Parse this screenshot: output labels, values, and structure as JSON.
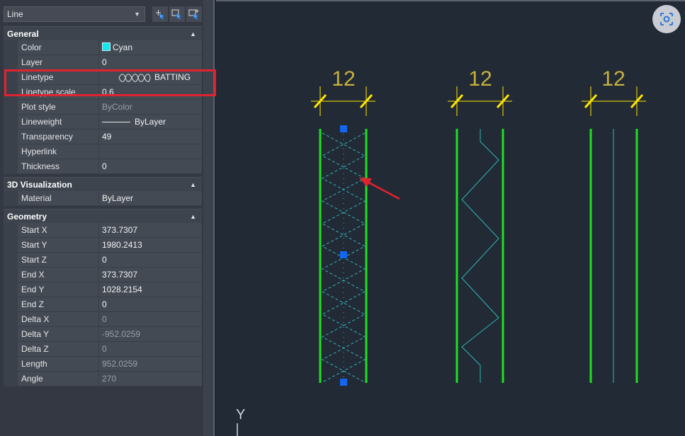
{
  "selector": {
    "value": "Line"
  },
  "toolbar": {
    "icons": [
      "select-objects-icon",
      "quick-select-icon",
      "toggle-pickadd-icon"
    ]
  },
  "sections": {
    "general": {
      "title": "General"
    },
    "viz": {
      "title": "3D Visualization"
    },
    "geometry": {
      "title": "Geometry"
    }
  },
  "general": {
    "color": {
      "label": "Color",
      "value": "Cyan"
    },
    "layer": {
      "label": "Layer",
      "value": "0"
    },
    "linetype": {
      "label": "Linetype",
      "value": "BATTING"
    },
    "linetype_scale": {
      "label": "Linetype scale",
      "value": "0.6"
    },
    "plot_style": {
      "label": "Plot style",
      "value": "ByColor"
    },
    "lineweight": {
      "label": "Lineweight",
      "value": "ByLayer"
    },
    "transparency": {
      "label": "Transparency",
      "value": "49"
    },
    "hyperlink": {
      "label": "Hyperlink",
      "value": ""
    },
    "thickness": {
      "label": "Thickness",
      "value": "0"
    }
  },
  "viz": {
    "material": {
      "label": "Material",
      "value": "ByLayer"
    }
  },
  "geometry": {
    "start_x": {
      "label": "Start X",
      "value": "373.7307"
    },
    "start_y": {
      "label": "Start Y",
      "value": "1980.2413"
    },
    "start_z": {
      "label": "Start Z",
      "value": "0"
    },
    "end_x": {
      "label": "End X",
      "value": "373.7307"
    },
    "end_y": {
      "label": "End Y",
      "value": "1028.2154"
    },
    "end_z": {
      "label": "End Z",
      "value": "0"
    },
    "delta_x": {
      "label": "Delta X",
      "value": "0"
    },
    "delta_y": {
      "label": "Delta Y",
      "value": "-952.0259"
    },
    "delta_z": {
      "label": "Delta Z",
      "value": "0"
    },
    "length": {
      "label": "Length",
      "value": "952.0259"
    },
    "angle": {
      "label": "Angle",
      "value": "270"
    }
  },
  "drawing": {
    "dimensions": [
      "12",
      "12",
      "12"
    ],
    "ucs_axis": "Y",
    "colors": {
      "wall_line": "#1fe01f",
      "batting": "#2fb6b8",
      "dimension": "#ffe600",
      "dim_text": "#c8b23c",
      "grip": "#1466f0",
      "annotation": "#e0232f"
    }
  }
}
